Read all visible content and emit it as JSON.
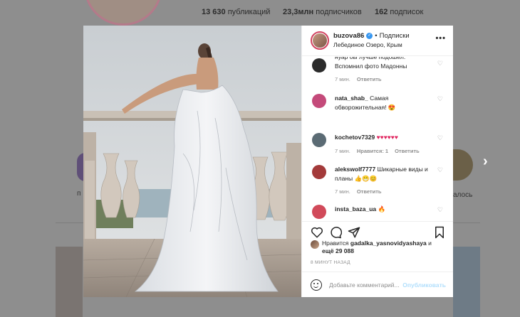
{
  "profile": {
    "stats": [
      {
        "value": "13 630",
        "label": "публикаций"
      },
      {
        "value": "23,3млн",
        "label": "подписчиков"
      },
      {
        "value": "162",
        "label": "подписок"
      }
    ],
    "highlights": [
      {
        "label": "п"
      },
      {
        "label": "алось"
      }
    ]
  },
  "post": {
    "header": {
      "username": "buzova86",
      "follow_label": "Подписки",
      "location": "Лебединое Озеро, Крым",
      "more_icon": "more-icon"
    },
    "comments": [
      {
        "user": "",
        "text": "нуар бы лучше подошёл. Вспомнил фото Мадонны",
        "time": "7 мин.",
        "likes": "",
        "reply": "Ответить",
        "avatar_color": "#2b2b2b"
      },
      {
        "user": "nata_shab_",
        "text": "Самая обворожительная! 😍",
        "time": "7 мин.",
        "likes": "",
        "reply": "Ответить",
        "avatar_color": "#c44a7a"
      },
      {
        "user": "kochetov7329",
        "text": "♥♥♥♥♥♥",
        "time": "7 мин.",
        "likes": "Нравится: 1",
        "reply": "Ответить",
        "avatar_color": "#5b6b74"
      },
      {
        "user": "alekswolf7777",
        "text": "Шикарные виды и планы 👍😁😊",
        "time": "7 мин.",
        "likes": "",
        "reply": "Ответить",
        "avatar_color": "#a33a3a"
      },
      {
        "user": "insta_baza_ua",
        "text": "🔥",
        "time": "",
        "likes": "",
        "reply": "",
        "avatar_color": "#d14a5a"
      }
    ],
    "likes": {
      "prefix": "Нравится",
      "user": "gadalka_yasnovidyashaya",
      "and": "и",
      "more": "ещё 29 088"
    },
    "time_ago": "8 минут назад",
    "add_comment_placeholder": "Добавьте комментарий...",
    "publish_label": "Опубликовать"
  },
  "colors": {
    "verified": "#3897f0",
    "publish_disabled": "#b2dffc",
    "story_ring": "#d2425f"
  }
}
